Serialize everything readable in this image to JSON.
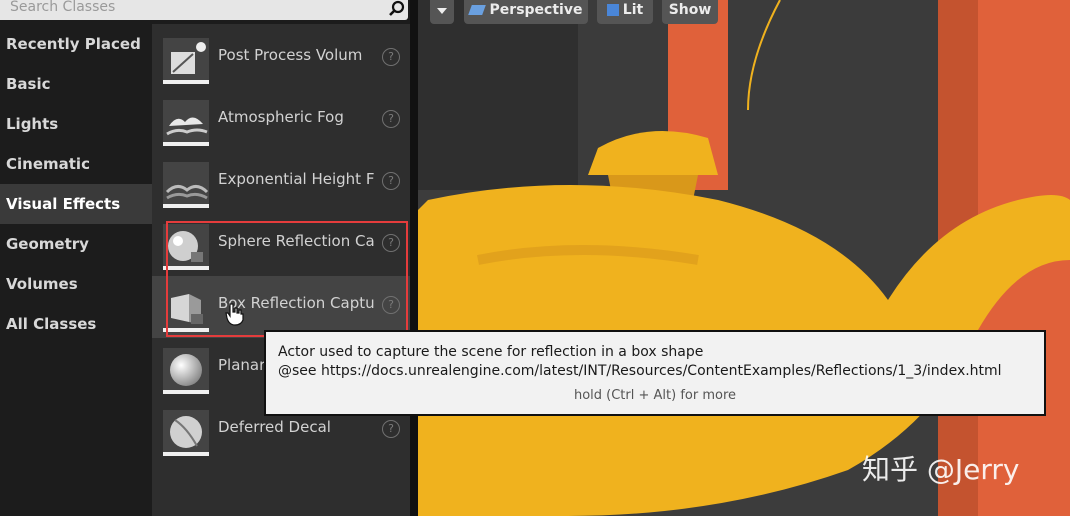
{
  "search": {
    "placeholder": "Search Classes",
    "icon": "search-icon"
  },
  "categories": [
    {
      "label": "Recently Placed"
    },
    {
      "label": "Basic"
    },
    {
      "label": "Lights"
    },
    {
      "label": "Cinematic"
    },
    {
      "label": "Visual Effects",
      "active": true
    },
    {
      "label": "Geometry"
    },
    {
      "label": "Volumes"
    },
    {
      "label": "All Classes"
    }
  ],
  "items": [
    {
      "label": "Post Process Volum",
      "icon": "post-process-volume-icon",
      "help": "?"
    },
    {
      "label": "Atmospheric Fog",
      "icon": "atmospheric-fog-icon",
      "help": "?"
    },
    {
      "label": "Exponential Height F",
      "icon": "exponential-height-fog-icon",
      "help": "?"
    },
    {
      "label": "Sphere Reflection Ca",
      "icon": "sphere-reflection-capture-icon",
      "help": "?"
    },
    {
      "label": "Box Reflection Captu",
      "icon": "box-reflection-capture-icon",
      "help": "?",
      "hovered": true
    },
    {
      "label": "Planar",
      "icon": "planar-reflection-icon",
      "help": "?"
    },
    {
      "label": "Deferred Decal",
      "icon": "deferred-decal-icon",
      "help": "?"
    }
  ],
  "viewport": {
    "menu_icon": "dropdown-arrow-icon",
    "perspective_label": "Perspective",
    "lit_label": "Lit",
    "show_label": "Show"
  },
  "tooltip": {
    "line1": "Actor used to capture the scene for reflection in a box shape",
    "line2": "@see https://docs.unrealengine.com/latest/INT/Resources/ContentExamples/Reflections/1_3/index.html",
    "hint": "hold (Ctrl + Alt) for more"
  },
  "watermark": "知乎 @Jerry",
  "colors": {
    "highlight": "#e53c3c",
    "teapot": "#f0b21e",
    "pillar": "#e0613a"
  }
}
